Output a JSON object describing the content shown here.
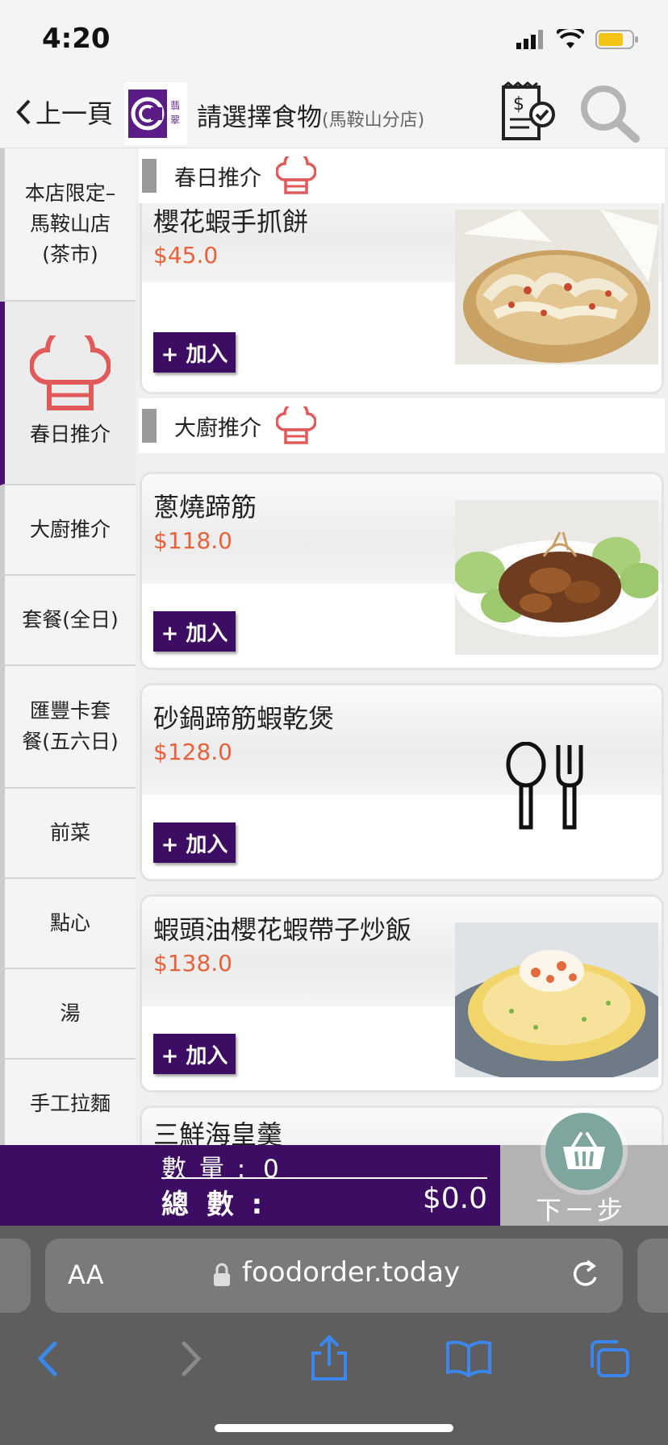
{
  "status": {
    "time": "4:20"
  },
  "header": {
    "back_label": "上一頁",
    "title": "請選擇食物",
    "branch": "(馬鞍山分店)",
    "logo_text": "翡翠"
  },
  "sidebar": {
    "items": [
      {
        "label": "本店限定–\n馬鞍山店\n(茶市)"
      },
      {
        "label": "春日推介",
        "active": true
      },
      {
        "label": "大廚推介"
      },
      {
        "label": "套餐(全日)"
      },
      {
        "label": "匯豐卡套\n餐(五六日)"
      },
      {
        "label": "前菜"
      },
      {
        "label": "點心"
      },
      {
        "label": "湯"
      },
      {
        "label": "手工拉麵"
      }
    ]
  },
  "sections": [
    {
      "label": "春日推介"
    },
    {
      "label": "大廚推介"
    }
  ],
  "items": [
    {
      "name": "櫻花蝦手抓餅",
      "price": "$45.0",
      "add_label": "+ 加入",
      "image": "crispy-pancake-basket"
    },
    {
      "name": "蔥燒蹄筋",
      "price": "$118.0",
      "add_label": "+ 加入",
      "image": "braised-tendon-dish"
    },
    {
      "name": "砂鍋蹄筋蝦乾煲",
      "price": "$128.0",
      "add_label": "+ 加入",
      "image": "spoon-fork-placeholder"
    },
    {
      "name": "蝦頭油櫻花蝦帶子炒飯",
      "price": "$138.0",
      "add_label": "+ 加入",
      "image": "fried-rice-plate"
    },
    {
      "name": "三鮮海皇羹"
    }
  ],
  "cart": {
    "qty_label": "數 量 :",
    "qty_value": "0",
    "total_label": "總 數 :",
    "total_value": "$0.0",
    "next_label": "下一步"
  },
  "browser": {
    "aa_label": "AA",
    "url": "foodorder.today"
  },
  "colors": {
    "brand_purple": "#3d0d63",
    "price_orange": "#e8613a",
    "chef_icon_red": "#e05a5a",
    "cart_green": "#7fa59f"
  }
}
